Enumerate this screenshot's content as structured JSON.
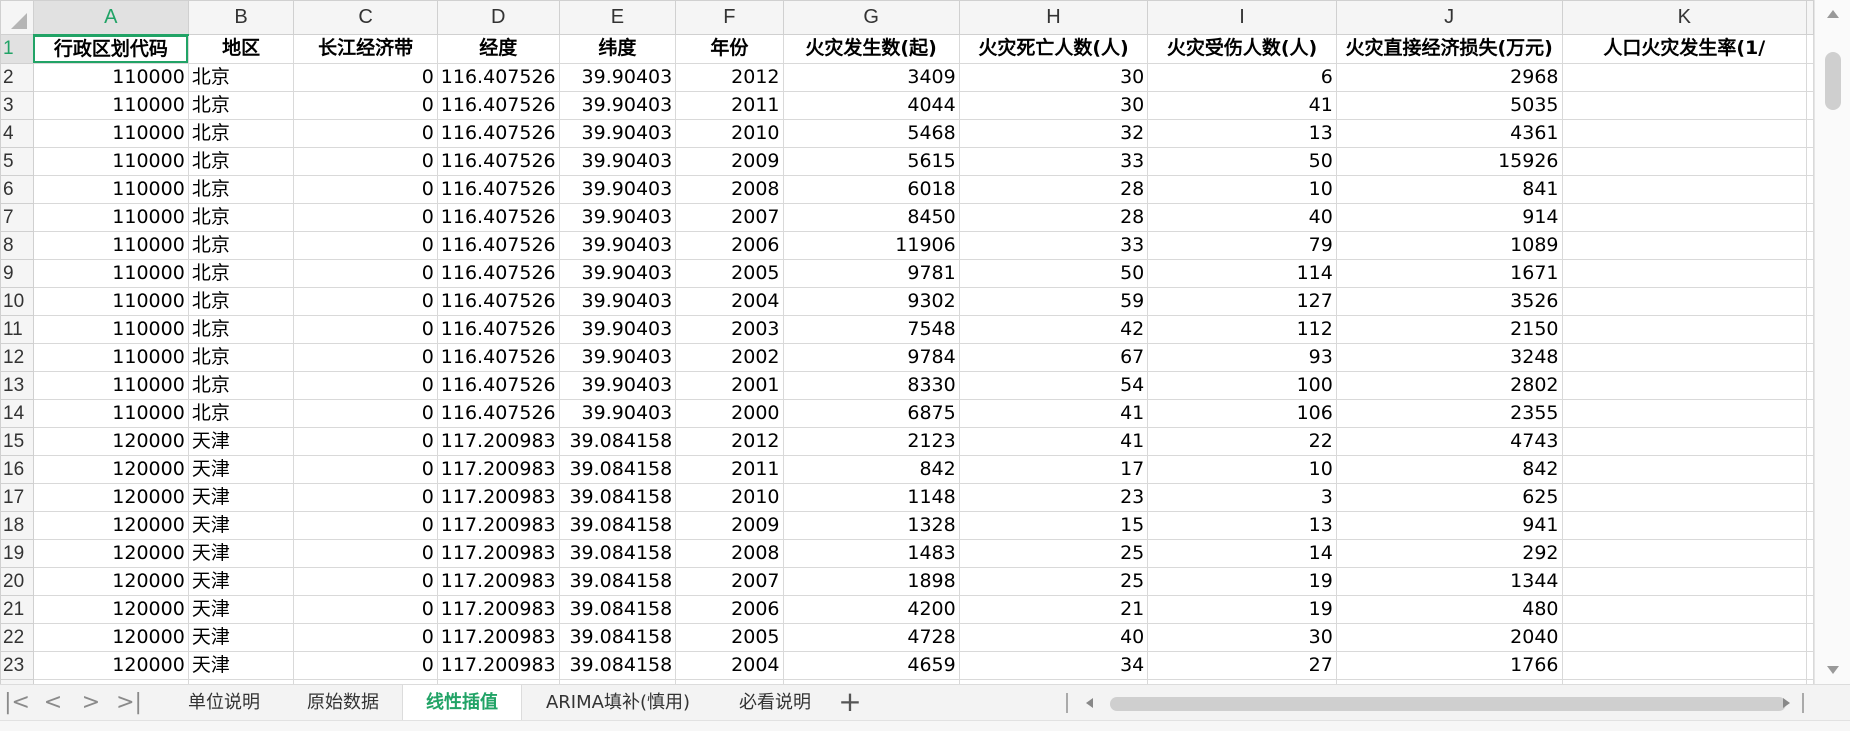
{
  "sheet": {
    "corner": "",
    "columns": [
      "A",
      "B",
      "C",
      "D",
      "E",
      "F",
      "G",
      "H",
      "I",
      "J",
      "K"
    ],
    "active_column": "A",
    "header_row": {
      "num": "1",
      "cells": [
        "行政区划代码",
        "地区",
        "长江经济带",
        "经度",
        "纬度",
        "年份",
        "火灾发生数(起)",
        "火灾死亡人数(人)",
        "火灾受伤人数(人)",
        "火灾直接经济损失(万元)",
        "人口火灾发生率(1/"
      ]
    },
    "rows": [
      {
        "num": "2",
        "cells": [
          "110000",
          "北京",
          "0",
          "116.407526",
          "39.90403",
          "2012",
          "3409",
          "30",
          "6",
          "2968",
          ""
        ]
      },
      {
        "num": "3",
        "cells": [
          "110000",
          "北京",
          "0",
          "116.407526",
          "39.90403",
          "2011",
          "4044",
          "30",
          "41",
          "5035",
          ""
        ]
      },
      {
        "num": "4",
        "cells": [
          "110000",
          "北京",
          "0",
          "116.407526",
          "39.90403",
          "2010",
          "5468",
          "32",
          "13",
          "4361",
          ""
        ]
      },
      {
        "num": "5",
        "cells": [
          "110000",
          "北京",
          "0",
          "116.407526",
          "39.90403",
          "2009",
          "5615",
          "33",
          "50",
          "15926",
          ""
        ]
      },
      {
        "num": "6",
        "cells": [
          "110000",
          "北京",
          "0",
          "116.407526",
          "39.90403",
          "2008",
          "6018",
          "28",
          "10",
          "841",
          ""
        ]
      },
      {
        "num": "7",
        "cells": [
          "110000",
          "北京",
          "0",
          "116.407526",
          "39.90403",
          "2007",
          "8450",
          "28",
          "40",
          "914",
          ""
        ]
      },
      {
        "num": "8",
        "cells": [
          "110000",
          "北京",
          "0",
          "116.407526",
          "39.90403",
          "2006",
          "11906",
          "33",
          "79",
          "1089",
          ""
        ]
      },
      {
        "num": "9",
        "cells": [
          "110000",
          "北京",
          "0",
          "116.407526",
          "39.90403",
          "2005",
          "9781",
          "50",
          "114",
          "1671",
          ""
        ]
      },
      {
        "num": "10",
        "cells": [
          "110000",
          "北京",
          "0",
          "116.407526",
          "39.90403",
          "2004",
          "9302",
          "59",
          "127",
          "3526",
          ""
        ]
      },
      {
        "num": "11",
        "cells": [
          "110000",
          "北京",
          "0",
          "116.407526",
          "39.90403",
          "2003",
          "7548",
          "42",
          "112",
          "2150",
          ""
        ]
      },
      {
        "num": "12",
        "cells": [
          "110000",
          "北京",
          "0",
          "116.407526",
          "39.90403",
          "2002",
          "9784",
          "67",
          "93",
          "3248",
          ""
        ]
      },
      {
        "num": "13",
        "cells": [
          "110000",
          "北京",
          "0",
          "116.407526",
          "39.90403",
          "2001",
          "8330",
          "54",
          "100",
          "2802",
          ""
        ]
      },
      {
        "num": "14",
        "cells": [
          "110000",
          "北京",
          "0",
          "116.407526",
          "39.90403",
          "2000",
          "6875",
          "41",
          "106",
          "2355",
          ""
        ]
      },
      {
        "num": "15",
        "cells": [
          "120000",
          "天津",
          "0",
          "117.200983",
          "39.084158",
          "2012",
          "2123",
          "41",
          "22",
          "4743",
          ""
        ]
      },
      {
        "num": "16",
        "cells": [
          "120000",
          "天津",
          "0",
          "117.200983",
          "39.084158",
          "2011",
          "842",
          "17",
          "10",
          "842",
          ""
        ]
      },
      {
        "num": "17",
        "cells": [
          "120000",
          "天津",
          "0",
          "117.200983",
          "39.084158",
          "2010",
          "1148",
          "23",
          "3",
          "625",
          ""
        ]
      },
      {
        "num": "18",
        "cells": [
          "120000",
          "天津",
          "0",
          "117.200983",
          "39.084158",
          "2009",
          "1328",
          "15",
          "13",
          "941",
          ""
        ]
      },
      {
        "num": "19",
        "cells": [
          "120000",
          "天津",
          "0",
          "117.200983",
          "39.084158",
          "2008",
          "1483",
          "25",
          "14",
          "292",
          ""
        ]
      },
      {
        "num": "20",
        "cells": [
          "120000",
          "天津",
          "0",
          "117.200983",
          "39.084158",
          "2007",
          "1898",
          "25",
          "19",
          "1344",
          ""
        ]
      },
      {
        "num": "21",
        "cells": [
          "120000",
          "天津",
          "0",
          "117.200983",
          "39.084158",
          "2006",
          "4200",
          "21",
          "19",
          "480",
          ""
        ]
      },
      {
        "num": "22",
        "cells": [
          "120000",
          "天津",
          "0",
          "117.200983",
          "39.084158",
          "2005",
          "4728",
          "40",
          "30",
          "2040",
          ""
        ]
      },
      {
        "num": "23",
        "cells": [
          "120000",
          "天津",
          "0",
          "117.200983",
          "39.084158",
          "2004",
          "4659",
          "34",
          "27",
          "1766",
          ""
        ]
      },
      {
        "num": "24",
        "cells": [
          "",
          "",
          "",
          "",
          "",
          "",
          "",
          "",
          "",
          "",
          ""
        ]
      }
    ]
  },
  "tabs": {
    "nav": [
      "|<",
      "<",
      ">",
      ">|"
    ],
    "items": [
      "单位说明",
      "原始数据",
      "线性插值",
      "ARIMA填补(慎用)",
      "必看说明"
    ],
    "active_index": 2,
    "add": "+"
  },
  "colors": {
    "accent": "#21a366",
    "header_bg": "#f5f5f5",
    "grid": "#d9d9d9"
  }
}
